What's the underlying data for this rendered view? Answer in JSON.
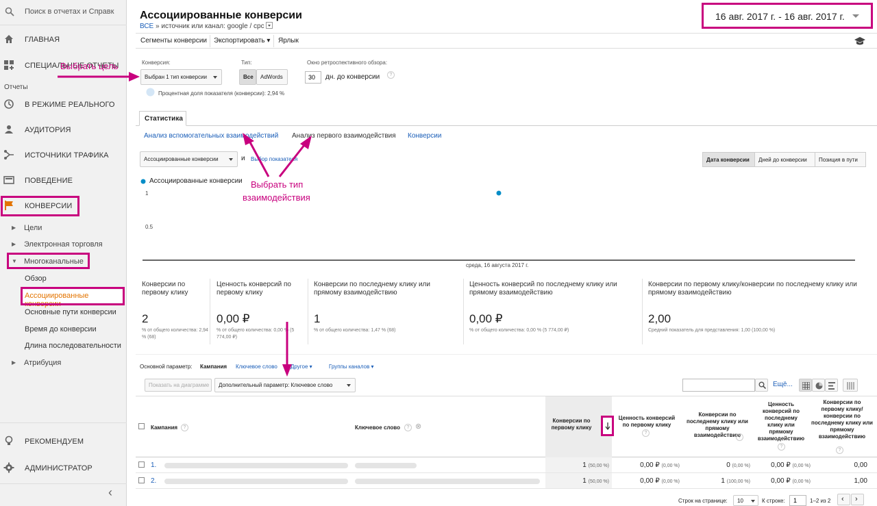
{
  "colors": {
    "accent": "#c8007e",
    "link": "#1a5eb8",
    "active_item": "#e37400",
    "series_dot": "#058dc7",
    "sidebar_bg": "#f1f1f1"
  },
  "sidebar": {
    "search_placeholder": "Поиск в отчетах и Справк",
    "home": "ГЛАВНАЯ",
    "special": "СПЕЦИАЛЬНЫЕ ОТЧЕТЫ",
    "reports_label": "Отчеты",
    "realtime": "В РЕЖИМЕ РЕАЛЬНОГО",
    "audience": "АУДИТОРИЯ",
    "traffic": "ИСТОЧНИКИ ТРАФИКА",
    "behavior": "ПОВЕДЕНИЕ",
    "conversions": "КОНВЕРСИИ",
    "goals": "Цели",
    "ecommerce": "Электронная торговля",
    "multichannel": "Многоканальные",
    "overview": "Обзор",
    "assisted": "Ассоциированные конверсии",
    "top_paths": "Основные пути конверсии",
    "time_lag": "Время до конверсии",
    "path_length": "Длина последовательности",
    "attribution": "Атрибуция",
    "recommend": "РЕКОМЕНДУЕМ",
    "admin": "АДМИНИСТРАТОР",
    "collapse": "‹"
  },
  "header": {
    "title": "Ассоциированные конверсии",
    "crumb_all": "ВСЕ",
    "crumb_sep": "»",
    "crumb_text": "источник или канал: google / cpc",
    "date_range": "16 авг. 2017 г. - 16 авг. 2017 г."
  },
  "toolbar": {
    "segments": "Сегменты конверсии",
    "export": "Экспортировать",
    "export_caret": "▾",
    "shortcut": "Ярлык"
  },
  "controls": {
    "conversion_label": "Конверсия:",
    "conversion_value": "Выбран 1 тип конверсии",
    "type_label": "Тип:",
    "type_all": "Все",
    "type_adwords": "AdWords",
    "lookback_label": "Окно ретроспективного обзора:",
    "lookback_value": "30",
    "lookback_suffix": "дн. до конверсии",
    "share_text": "Процентная доля показателя (конверсии): 2,94 %"
  },
  "tabs": {
    "stats": "Статистика"
  },
  "subnav": {
    "assist": "Анализ вспомогательных взаимодействий",
    "first": "Анализ первого взаимодействия",
    "conv": "Конверсии"
  },
  "metric_select": {
    "value": "Ассоциированные конверсии",
    "and": "и",
    "choose": "Выбор показателя"
  },
  "view_buttons": {
    "date": "Дата конверсии",
    "days": "Дней до конверсии",
    "position": "Позиция в пути"
  },
  "chart_data": {
    "type": "scatter",
    "series": [
      {
        "name": "Ассоциированные конверсии",
        "values": [
          1
        ]
      }
    ],
    "categories": [
      "среда, 16 августа 2017 г."
    ],
    "y_ticks": [
      "1",
      "0.5"
    ],
    "ylim": [
      0,
      1
    ]
  },
  "metrics": [
    {
      "label": "Конверсии по первому клику",
      "value": "2",
      "sub": "% от общего количества: 2,94 % (68)"
    },
    {
      "label": "Ценность конверсий по первому клику",
      "value": "0,00 ₽",
      "sub": "% от общего количества: 0,00 % (5 774,00 ₽)"
    },
    {
      "label": "Конверсии по последнему клику или прямому взаимодействию",
      "value": "1",
      "sub": "% от общего количества: 1,47 % (68)"
    },
    {
      "label": "Ценность конверсий по последнему клику или прямому взаимодействию",
      "value": "0,00 ₽",
      "sub": "% от общего количества: 0,00 % (5 774,00 ₽)"
    },
    {
      "label": "Конверсии по первому клику/конверсии по последнему клику или прямому взаимодействию",
      "value": "2,00",
      "sub": "Средний показатель для представления: 1,00 (100,00 %)"
    }
  ],
  "dimension_bar": {
    "primary_label": "Основной параметр:",
    "campaign": "Кампания",
    "keyword": "Ключевое слово",
    "other": "Другое",
    "groups": "Группы каналов"
  },
  "table_controls": {
    "plot_rows": "Показать на диаграмме",
    "secondary": "Дополнительный параметр: Ключевое слово",
    "more": "Ещё..."
  },
  "table": {
    "headers": {
      "campaign": "Кампания",
      "keyword": "Ключевое слово",
      "c1": "Конверсии по первому клику",
      "c2": "Ценность конверсий по первому клику",
      "c3": "Конверсии по последнему клику или прямому взаимодействию",
      "c4": "Ценность конверсий по последнему клику или прямому взаимодействию",
      "c5": "Конверсии по первому клику/ конверсии по последнему клику или прямому взаимодействию"
    },
    "rows": [
      {
        "idx": "1.",
        "c1": "1",
        "c1p": "(50,00 %)",
        "c2": "0,00 ₽",
        "c2p": "(0,00 %)",
        "c3": "0",
        "c3p": "(0,00 %)",
        "c4": "0,00 ₽",
        "c4p": "(0,00 %)",
        "c5": "0,00"
      },
      {
        "idx": "2.",
        "c1": "1",
        "c1p": "(50,00 %)",
        "c2": "0,00 ₽",
        "c2p": "(0,00 %)",
        "c3": "1",
        "c3p": "(100,00 %)",
        "c4": "0,00 ₽",
        "c4p": "(0,00 %)",
        "c5": "1,00"
      }
    ]
  },
  "pagination": {
    "rows_label": "Строк на странице:",
    "rows_value": "10",
    "goto_label": "К строке:",
    "goto_value": "1",
    "range": "1–2 из 2"
  },
  "annotations": {
    "goal": "Выбрать цель",
    "type_line1": "Выбрать тип",
    "type_line2": "взаимодействия"
  }
}
